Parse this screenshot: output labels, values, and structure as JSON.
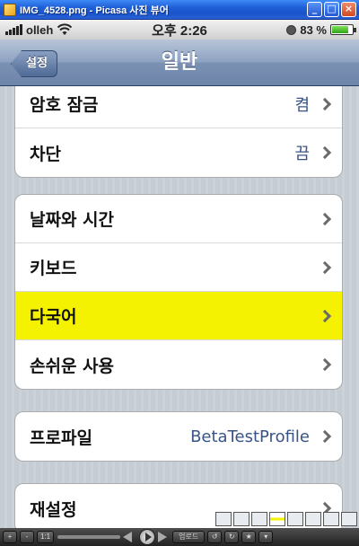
{
  "window": {
    "title": "IMG_4528.png - Picasa 사진 뷰어",
    "buttons": [
      "_",
      "□",
      "×"
    ]
  },
  "status_bar": {
    "carrier": "olleh",
    "time": "오후 2:26",
    "battery_percent": "83 %",
    "battery_level": 0.83
  },
  "nav": {
    "back_label": "설정",
    "title": "일반"
  },
  "groups": [
    {
      "rows": [
        {
          "label": "암호 잠금",
          "value": "켬"
        },
        {
          "label": "차단",
          "value": "끔"
        }
      ]
    },
    {
      "rows": [
        {
          "label": "날짜와 시간",
          "value": ""
        },
        {
          "label": "키보드",
          "value": ""
        },
        {
          "label": "다국어",
          "value": "",
          "highlighted": true
        },
        {
          "label": "손쉬운 사용",
          "value": ""
        }
      ]
    },
    {
      "rows": [
        {
          "label": "프로파일",
          "value": "BetaTestProfile"
        }
      ]
    },
    {
      "rows": [
        {
          "label": "재설정",
          "value": ""
        }
      ]
    }
  ],
  "toolbar": {
    "zoom_in": "+",
    "zoom_out": "-",
    "actual_size": "1:1",
    "upload": "업로드"
  },
  "colors": {
    "highlight": "#f4f200",
    "value_text": "#385487",
    "nav_bar": "#8ea3c2"
  }
}
